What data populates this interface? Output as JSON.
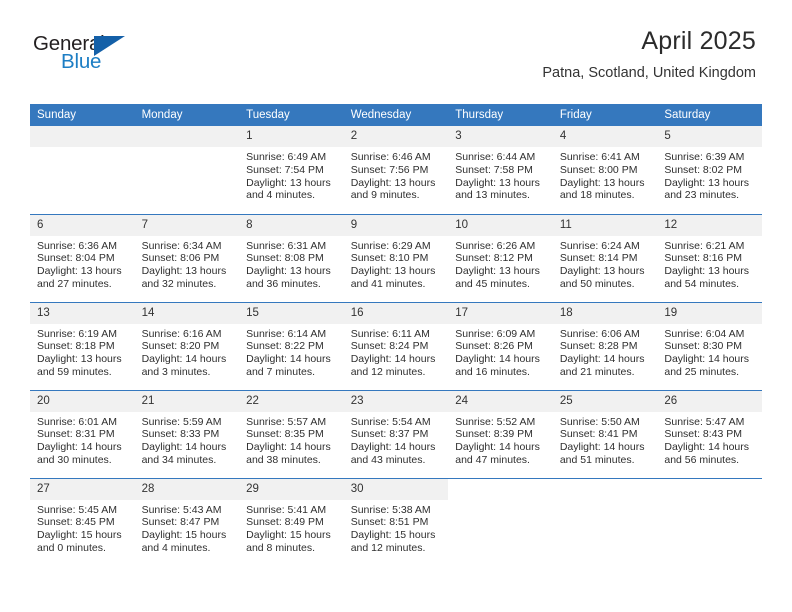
{
  "logo": {
    "primary_text": "General",
    "secondary_text": "Blue",
    "triangle_color": "#1460a8",
    "secondary_color": "#1d7ec4"
  },
  "header": {
    "title": "April 2025",
    "subtitle": "Patna, Scotland, United Kingdom"
  },
  "theme": {
    "header_bg": "#3578be",
    "daynum_bg": "#f1f1f1",
    "text": "#2f2f2f",
    "row_divider": "#3578be"
  },
  "calendar": {
    "weekday_headers": [
      "Sunday",
      "Monday",
      "Tuesday",
      "Wednesday",
      "Thursday",
      "Friday",
      "Saturday"
    ],
    "weeks": [
      [
        {
          "day": "",
          "blank": true
        },
        {
          "day": "",
          "blank": true
        },
        {
          "day": "1",
          "sunrise": "Sunrise: 6:49 AM",
          "sunset": "Sunset: 7:54 PM",
          "daylight": "Daylight: 13 hours and 4 minutes."
        },
        {
          "day": "2",
          "sunrise": "Sunrise: 6:46 AM",
          "sunset": "Sunset: 7:56 PM",
          "daylight": "Daylight: 13 hours and 9 minutes."
        },
        {
          "day": "3",
          "sunrise": "Sunrise: 6:44 AM",
          "sunset": "Sunset: 7:58 PM",
          "daylight": "Daylight: 13 hours and 13 minutes."
        },
        {
          "day": "4",
          "sunrise": "Sunrise: 6:41 AM",
          "sunset": "Sunset: 8:00 PM",
          "daylight": "Daylight: 13 hours and 18 minutes."
        },
        {
          "day": "5",
          "sunrise": "Sunrise: 6:39 AM",
          "sunset": "Sunset: 8:02 PM",
          "daylight": "Daylight: 13 hours and 23 minutes."
        }
      ],
      [
        {
          "day": "6",
          "sunrise": "Sunrise: 6:36 AM",
          "sunset": "Sunset: 8:04 PM",
          "daylight": "Daylight: 13 hours and 27 minutes."
        },
        {
          "day": "7",
          "sunrise": "Sunrise: 6:34 AM",
          "sunset": "Sunset: 8:06 PM",
          "daylight": "Daylight: 13 hours and 32 minutes."
        },
        {
          "day": "8",
          "sunrise": "Sunrise: 6:31 AM",
          "sunset": "Sunset: 8:08 PM",
          "daylight": "Daylight: 13 hours and 36 minutes."
        },
        {
          "day": "9",
          "sunrise": "Sunrise: 6:29 AM",
          "sunset": "Sunset: 8:10 PM",
          "daylight": "Daylight: 13 hours and 41 minutes."
        },
        {
          "day": "10",
          "sunrise": "Sunrise: 6:26 AM",
          "sunset": "Sunset: 8:12 PM",
          "daylight": "Daylight: 13 hours and 45 minutes."
        },
        {
          "day": "11",
          "sunrise": "Sunrise: 6:24 AM",
          "sunset": "Sunset: 8:14 PM",
          "daylight": "Daylight: 13 hours and 50 minutes."
        },
        {
          "day": "12",
          "sunrise": "Sunrise: 6:21 AM",
          "sunset": "Sunset: 8:16 PM",
          "daylight": "Daylight: 13 hours and 54 minutes."
        }
      ],
      [
        {
          "day": "13",
          "sunrise": "Sunrise: 6:19 AM",
          "sunset": "Sunset: 8:18 PM",
          "daylight": "Daylight: 13 hours and 59 minutes."
        },
        {
          "day": "14",
          "sunrise": "Sunrise: 6:16 AM",
          "sunset": "Sunset: 8:20 PM",
          "daylight": "Daylight: 14 hours and 3 minutes."
        },
        {
          "day": "15",
          "sunrise": "Sunrise: 6:14 AM",
          "sunset": "Sunset: 8:22 PM",
          "daylight": "Daylight: 14 hours and 7 minutes."
        },
        {
          "day": "16",
          "sunrise": "Sunrise: 6:11 AM",
          "sunset": "Sunset: 8:24 PM",
          "daylight": "Daylight: 14 hours and 12 minutes."
        },
        {
          "day": "17",
          "sunrise": "Sunrise: 6:09 AM",
          "sunset": "Sunset: 8:26 PM",
          "daylight": "Daylight: 14 hours and 16 minutes."
        },
        {
          "day": "18",
          "sunrise": "Sunrise: 6:06 AM",
          "sunset": "Sunset: 8:28 PM",
          "daylight": "Daylight: 14 hours and 21 minutes."
        },
        {
          "day": "19",
          "sunrise": "Sunrise: 6:04 AM",
          "sunset": "Sunset: 8:30 PM",
          "daylight": "Daylight: 14 hours and 25 minutes."
        }
      ],
      [
        {
          "day": "20",
          "sunrise": "Sunrise: 6:01 AM",
          "sunset": "Sunset: 8:31 PM",
          "daylight": "Daylight: 14 hours and 30 minutes."
        },
        {
          "day": "21",
          "sunrise": "Sunrise: 5:59 AM",
          "sunset": "Sunset: 8:33 PM",
          "daylight": "Daylight: 14 hours and 34 minutes."
        },
        {
          "day": "22",
          "sunrise": "Sunrise: 5:57 AM",
          "sunset": "Sunset: 8:35 PM",
          "daylight": "Daylight: 14 hours and 38 minutes."
        },
        {
          "day": "23",
          "sunrise": "Sunrise: 5:54 AM",
          "sunset": "Sunset: 8:37 PM",
          "daylight": "Daylight: 14 hours and 43 minutes."
        },
        {
          "day": "24",
          "sunrise": "Sunrise: 5:52 AM",
          "sunset": "Sunset: 8:39 PM",
          "daylight": "Daylight: 14 hours and 47 minutes."
        },
        {
          "day": "25",
          "sunrise": "Sunrise: 5:50 AM",
          "sunset": "Sunset: 8:41 PM",
          "daylight": "Daylight: 14 hours and 51 minutes."
        },
        {
          "day": "26",
          "sunrise": "Sunrise: 5:47 AM",
          "sunset": "Sunset: 8:43 PM",
          "daylight": "Daylight: 14 hours and 56 minutes."
        }
      ],
      [
        {
          "day": "27",
          "sunrise": "Sunrise: 5:45 AM",
          "sunset": "Sunset: 8:45 PM",
          "daylight": "Daylight: 15 hours and 0 minutes."
        },
        {
          "day": "28",
          "sunrise": "Sunrise: 5:43 AM",
          "sunset": "Sunset: 8:47 PM",
          "daylight": "Daylight: 15 hours and 4 minutes."
        },
        {
          "day": "29",
          "sunrise": "Sunrise: 5:41 AM",
          "sunset": "Sunset: 8:49 PM",
          "daylight": "Daylight: 15 hours and 8 minutes."
        },
        {
          "day": "30",
          "sunrise": "Sunrise: 5:38 AM",
          "sunset": "Sunset: 8:51 PM",
          "daylight": "Daylight: 15 hours and 12 minutes."
        },
        {
          "day": "",
          "blank": true
        },
        {
          "day": "",
          "blank": true
        },
        {
          "day": "",
          "blank": true
        }
      ]
    ]
  }
}
